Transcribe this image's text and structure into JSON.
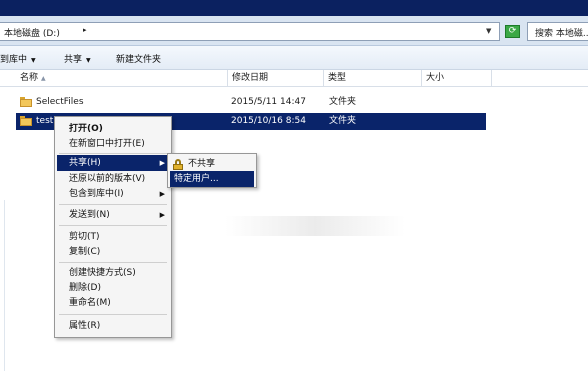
{
  "address": {
    "path": "本地磁盘 (D:)",
    "search_placeholder": "搜索 本地磁..."
  },
  "toolbar": {
    "include_label": "到库中",
    "share_label": "共享",
    "new_folder_label": "新建文件夹"
  },
  "columns": {
    "name": "名称",
    "date": "修改日期",
    "type": "类型",
    "size": "大小"
  },
  "files": [
    {
      "name": "SelectFiles",
      "date": "2015/5/11 14:47",
      "type": "文件夹"
    },
    {
      "name": "test",
      "date": "2015/10/16 8:54",
      "type": "文件夹"
    }
  ],
  "context_menu": {
    "open": "打开(O)",
    "open_new_window": "在新窗口中打开(E)",
    "share": "共享(H)",
    "restore": "还原以前的版本(V)",
    "include_library": "包含到库中(I)",
    "send_to": "发送到(N)",
    "cut": "剪切(T)",
    "copy": "复制(C)",
    "create_shortcut": "创建快捷方式(S)",
    "delete": "删除(D)",
    "rename": "重命名(M)",
    "properties": "属性(R)"
  },
  "share_submenu": {
    "nobody": "不共享",
    "specific_people": "特定用户..."
  },
  "colors": {
    "selection": "#0a246a",
    "titlebar": "#0b2160",
    "address_bg": "#d9e4f1"
  }
}
